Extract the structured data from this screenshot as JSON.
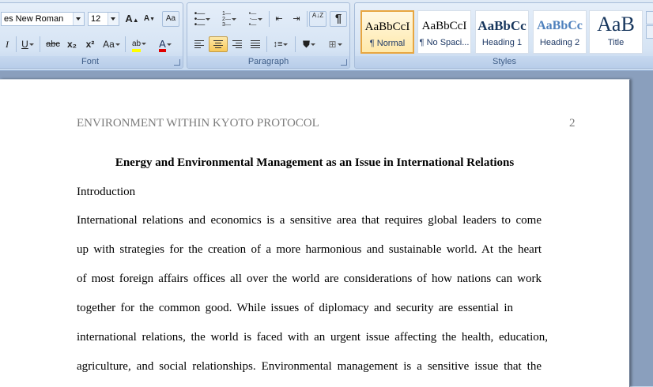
{
  "ribbon": {
    "font": {
      "label": "Font",
      "font_name": "es New Roman",
      "font_size": "12",
      "grow_font": "A",
      "shrink_font": "A",
      "clear_format": "Aa",
      "italic": "I",
      "underline": "U",
      "strike": "abc",
      "subscript": "x₂",
      "superscript": "x²",
      "change_case": "Aa",
      "highlight": "ab",
      "font_color": "A",
      "highlight_color": "#ffff00",
      "font_color_value": "#e00000"
    },
    "paragraph": {
      "label": "Paragraph",
      "pilcrow": "¶",
      "sort": "A↓Z"
    },
    "styles": {
      "label": "Styles",
      "items": [
        {
          "sample": "AaBbCcI",
          "name": "¶ Normal",
          "active": true
        },
        {
          "sample": "AaBbCcI",
          "name": "¶ No Spaci...",
          "active": false
        },
        {
          "sample": "AaBbCc",
          "name": "Heading 1",
          "active": false
        },
        {
          "sample": "AaBbCc",
          "name": "Heading 2",
          "active": false
        },
        {
          "sample": "AaB",
          "name": "Title",
          "active": false
        }
      ]
    }
  },
  "document": {
    "header": "ENVIRONMENT WITHIN KYOTO PROTOCOL",
    "page_number": "2",
    "title": "Energy and Environmental Management as an Issue in International Relations",
    "section_heading": "Introduction",
    "lines": [
      "International relations and economics is a sensitive area that requires global leaders to come",
      "up with strategies for the creation of a more harmonious and sustainable world. At the heart",
      "of most foreign affairs offices all over the world are considerations of how nations can work",
      "together for the common good. While issues of diplomacy and security are essential in",
      "international relations, the world is faced with an urgent issue affecting the health, education,",
      "agriculture, and social relationships.  Environmental management is a sensitive issue that the"
    ]
  },
  "colors": {
    "ribbon_label": "#3e5d87",
    "active_style_border": "#e8a640",
    "heading_blue": "#17365d"
  }
}
